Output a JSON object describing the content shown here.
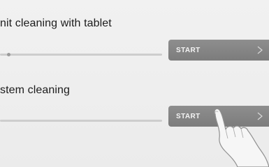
{
  "rows": [
    {
      "title": "nit cleaning with tablet",
      "button_label": "START",
      "chevron_icon": "chevron-right-icon"
    },
    {
      "title": "stem cleaning",
      "button_label": "START",
      "chevron_icon": "chevron-right-icon"
    }
  ],
  "icons": {
    "hand": "pointing-hand-icon"
  }
}
